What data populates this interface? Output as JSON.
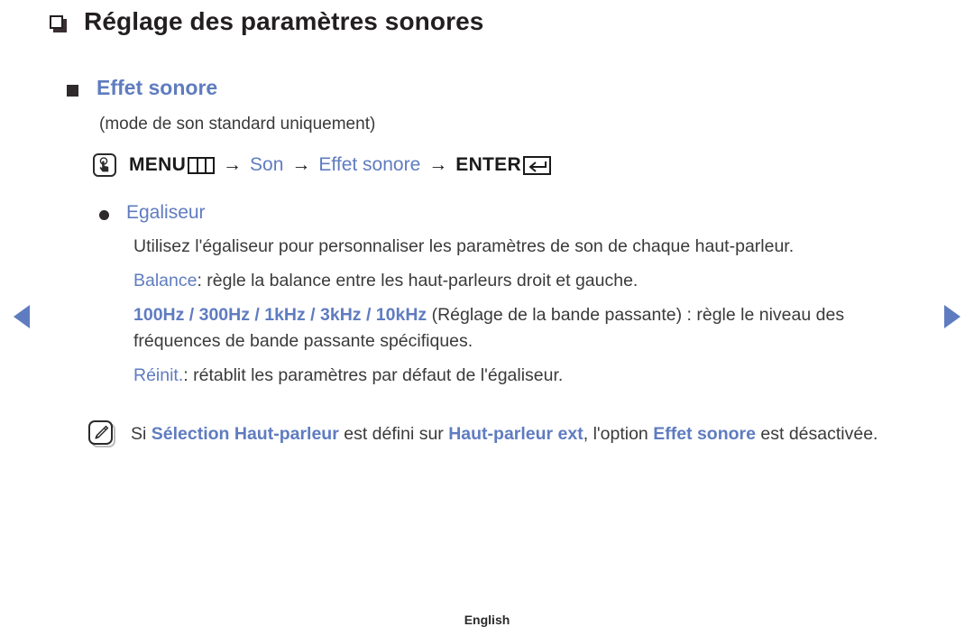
{
  "page": {
    "title": "Réglage des paramètres sonores",
    "title_icon": "square-outline-icon",
    "footer_language": "English",
    "accent_color": "#5f7cc0",
    "text_color": "#3a3a3a"
  },
  "section": {
    "bullet_icon": "filled-square-bullet-icon",
    "title": "Effet sonore",
    "subnote": "(mode de son standard uniquement)"
  },
  "menu_path": {
    "key_icon": "hand-press-button-icon",
    "menu_label": "MENU",
    "menu_glyph": "menu-grid-icon",
    "arrow": "→",
    "step_son": "Son",
    "step_effet_sonore": "Effet sonore",
    "enter_label": "ENTER",
    "enter_glyph": "enter-return-icon"
  },
  "item": {
    "bullet_icon": "filled-circle-bullet-icon",
    "title": "Egaliseur",
    "paragraph_1": "Utilisez l'égaliseur pour personnaliser les paramètres de son de chaque haut-parleur.",
    "balance_term": "Balance",
    "balance_desc": ": règle la balance entre les haut-parleurs droit et gauche.",
    "bands_term": "100Hz / 300Hz / 1kHz / 3kHz / 10kHz",
    "bands_desc": " (Réglage de la bande passante) : règle le niveau des fréquences de bande passante spécifiques.",
    "reset_term": "Réinit.",
    "reset_desc": ": rétablit les paramètres par défaut de l'égaliseur."
  },
  "note": {
    "icon": "note-pencil-icon",
    "prefix": "Si ",
    "term_1": "Sélection Haut-parleur",
    "mid_1": " est défini sur ",
    "term_2": "Haut-parleur ext",
    "mid_2": ", l'option ",
    "term_3": "Effet sonore",
    "suffix": " est désactivée."
  },
  "nav": {
    "prev_icon": "triangle-left-icon",
    "next_icon": "triangle-right-icon"
  }
}
